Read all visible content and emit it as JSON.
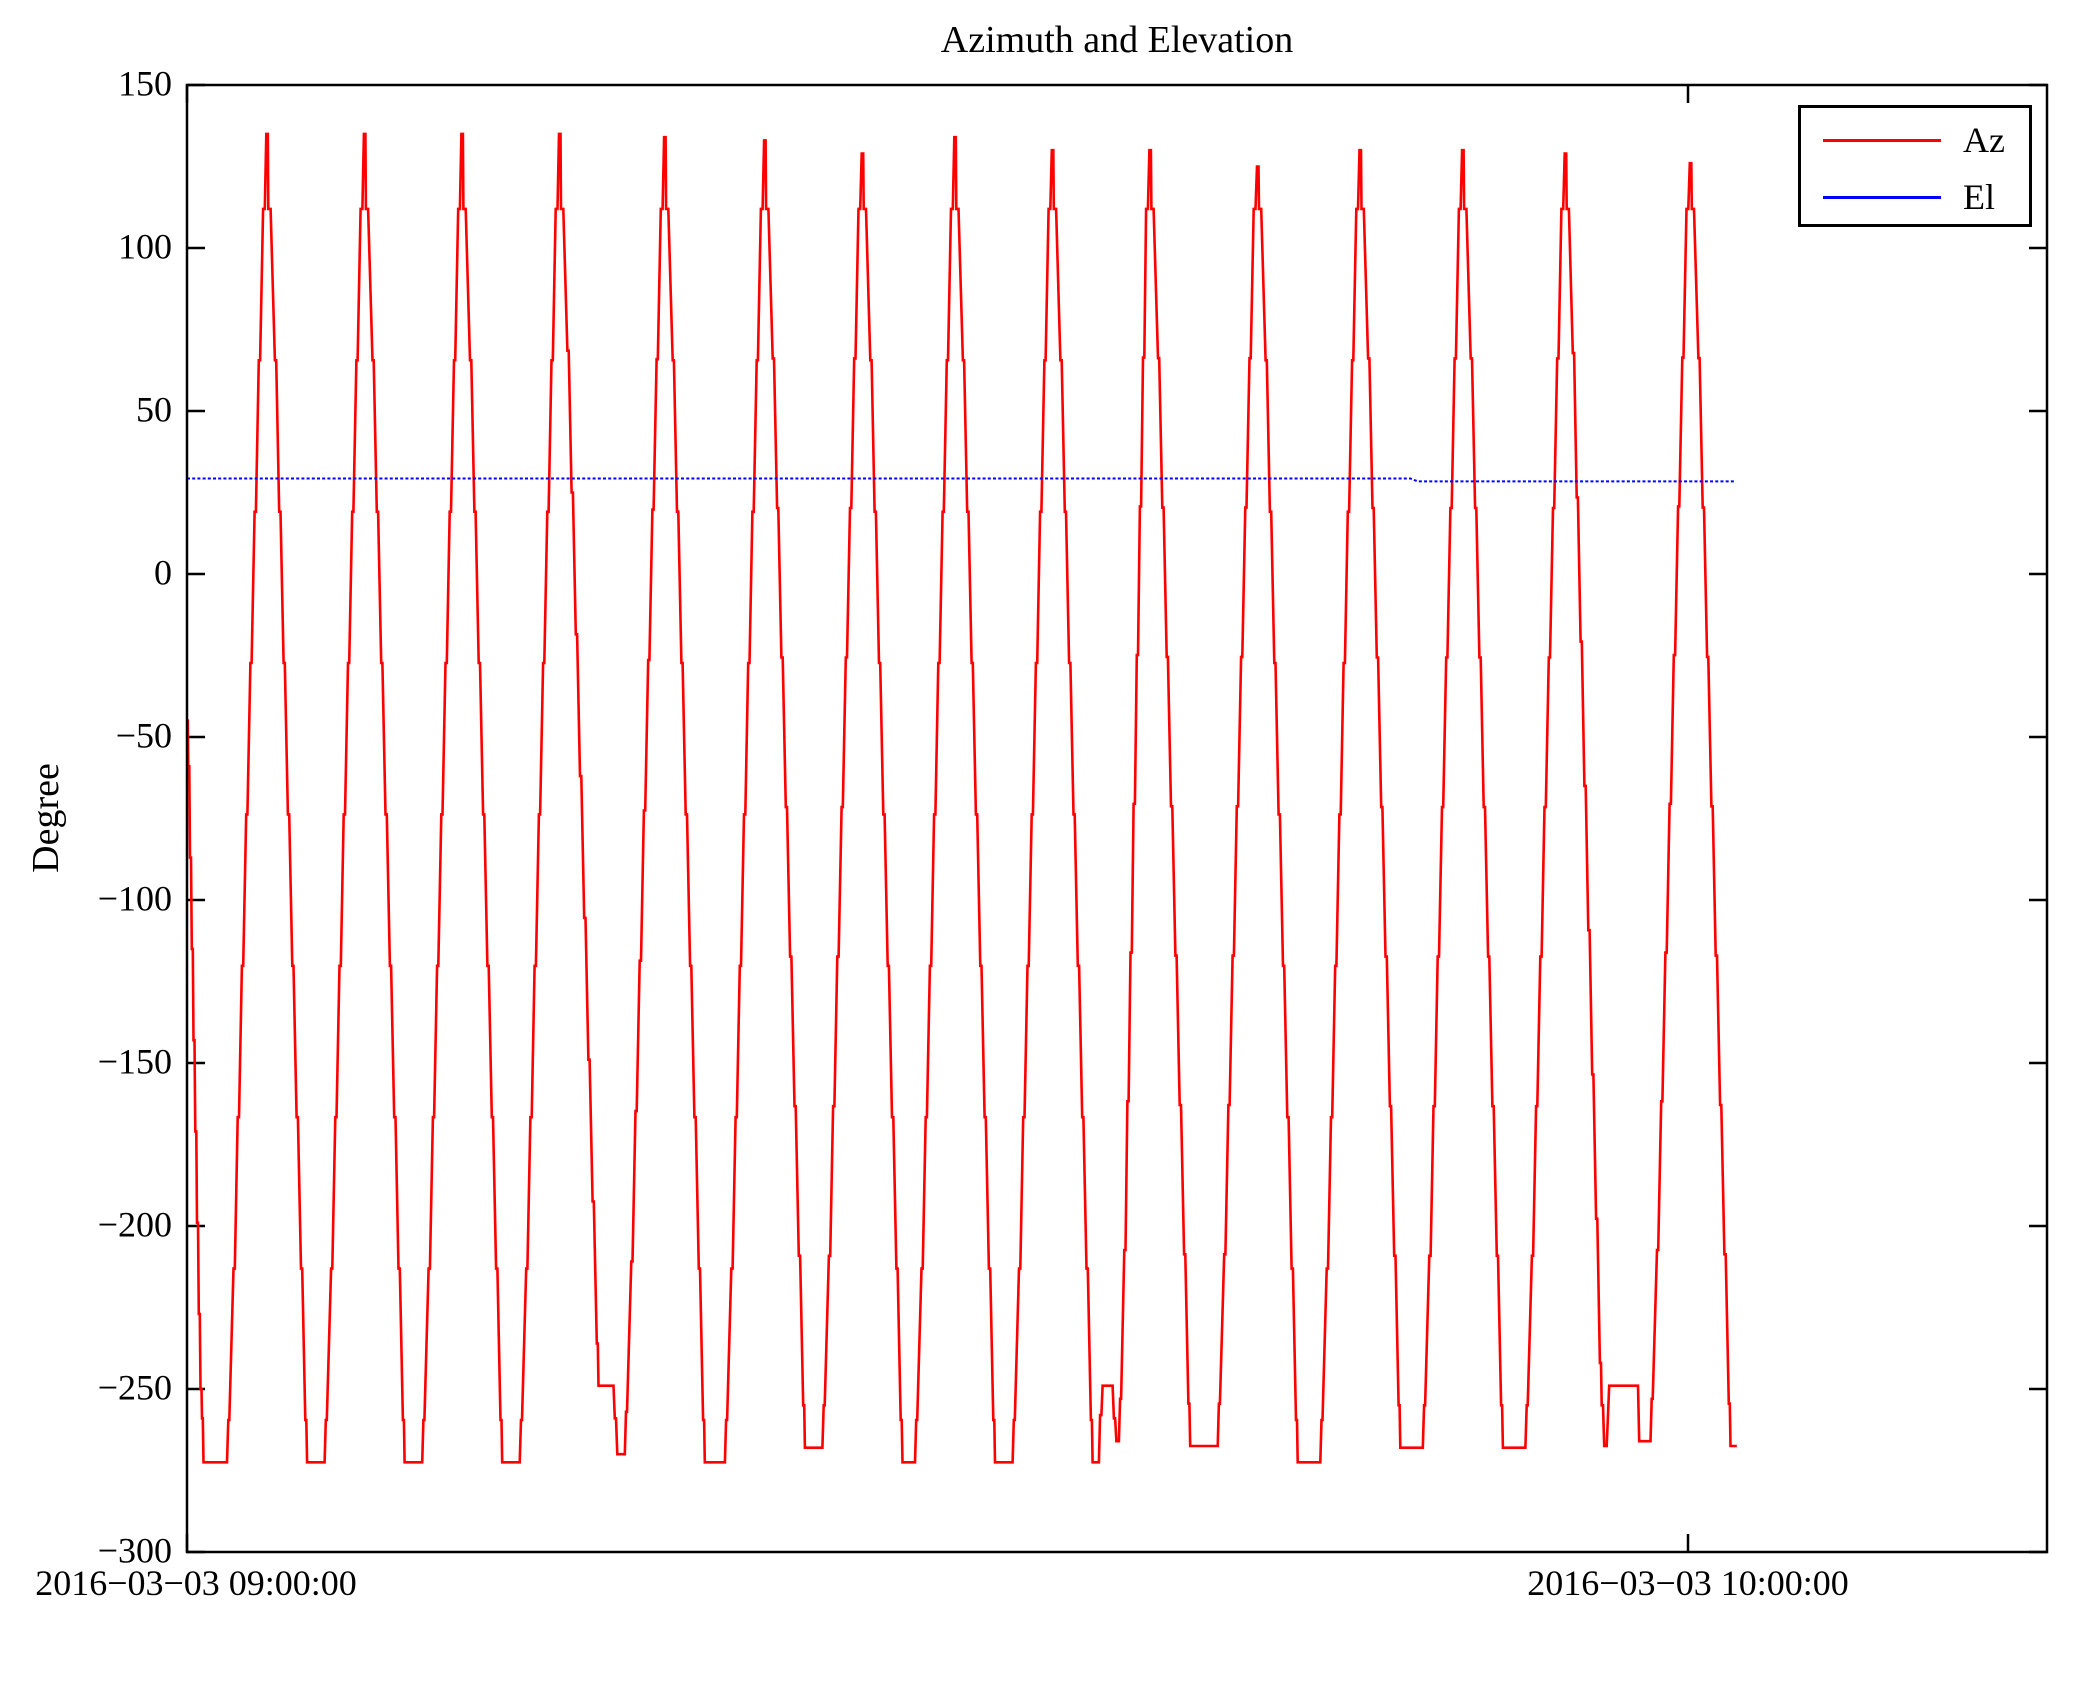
{
  "figure": {
    "background": "#ffffff"
  },
  "chart_data": {
    "type": "line",
    "title": "Azimuth and Elevation",
    "ylabel": "Degree",
    "grid": false,
    "ylim": [
      -300,
      150
    ],
    "yticks": [
      150,
      100,
      50,
      0,
      -50,
      -100,
      -150,
      -200,
      -250,
      -300
    ],
    "ytick_labels": [
      "150",
      "100",
      "50",
      "0",
      "−50",
      "−100",
      "−150",
      "−200",
      "−250",
      "−300"
    ],
    "xlim_minutes": [
      0,
      74.35
    ],
    "xticks": [
      {
        "t": 0,
        "label": "2016−03−03 09:00:00"
      },
      {
        "t": 60,
        "label": "2016−03−03 10:00:00"
      }
    ],
    "legend": {
      "position": "upper right",
      "entries": [
        {
          "label": "Az",
          "color": "#ff0000"
        },
        {
          "label": "El",
          "color": "#0000ff"
        }
      ]
    },
    "series": [
      {
        "name": "Az",
        "color": "#ff0000",
        "style": "solid",
        "description": "Azimuth sweeps repeatedly between about -273 and +135 degrees in stepped ramps, one cycle roughly every 4 minutes from 09:00 to 10:02",
        "initial_points": [
          [
            0,
            -45
          ],
          [
            0.03,
            -45
          ],
          [
            0.05,
            -59
          ],
          [
            0.09,
            -59
          ],
          [
            0.12,
            -87
          ],
          [
            0.16,
            -87
          ],
          [
            0.19,
            -115
          ],
          [
            0.23,
            -115
          ],
          [
            0.26,
            -143
          ],
          [
            0.3,
            -143
          ],
          [
            0.33,
            -171
          ],
          [
            0.37,
            -171
          ],
          [
            0.4,
            -199
          ],
          [
            0.44,
            -199
          ],
          [
            0.47,
            -227
          ],
          [
            0.51,
            -227
          ],
          [
            0.54,
            -250
          ],
          [
            0.58,
            -250
          ],
          [
            0.6,
            -259
          ],
          [
            0.63,
            -259
          ],
          [
            0.66,
            -272.5
          ]
        ],
        "cycles": [
          {
            "t": 3.2,
            "v": 135
          },
          {
            "t": 7.1,
            "v": 135
          },
          {
            "t": 11.0,
            "v": 135
          },
          {
            "t": 14.9,
            "v": 135
          },
          {
            "t": 19.1,
            "v": 134
          },
          {
            "t": 23.1,
            "v": 133
          },
          {
            "t": 27.0,
            "v": 129
          },
          {
            "t": 30.7,
            "v": 134
          },
          {
            "t": 34.6,
            "v": 130
          },
          {
            "t": 38.5,
            "v": 130
          },
          {
            "t": 42.8,
            "v": 125
          },
          {
            "t": 46.9,
            "v": 130
          },
          {
            "t": 51.0,
            "v": 130
          },
          {
            "t": 55.1,
            "v": 129
          },
          {
            "t": 60.1,
            "v": 126
          }
        ],
        "bottoms": [
          -272.5,
          -272.5,
          -272.5,
          {
            "shape": [
              [
                16.45,
                -249
              ],
              [
                17.05,
                -249
              ],
              [
                17.1,
                -259
              ],
              [
                17.15,
                -259
              ],
              [
                17.2,
                -270
              ],
              [
                17.35,
                -270
              ]
            ]
          },
          -272.5,
          -268,
          -272.5,
          -272.5,
          {
            "shape": [
              [
                36.2,
                -272.5
              ],
              [
                36.45,
                -272.5
              ],
              [
                36.5,
                -258
              ],
              [
                36.55,
                -258
              ],
              [
                36.6,
                -249
              ],
              [
                37.0,
                -249
              ],
              [
                37.05,
                -259
              ],
              [
                37.1,
                -259
              ],
              [
                37.15,
                -266
              ],
              [
                37.25,
                -266
              ]
            ]
          },
          -267.5,
          -272.5,
          -268,
          -268,
          {
            "shape": [
              [
                56.55,
                -255
              ],
              [
                56.6,
                -255
              ],
              [
                56.65,
                -267.5
              ],
              [
                56.75,
                -267.5
              ],
              [
                56.85,
                -249
              ],
              [
                58.0,
                -249
              ],
              [
                58.05,
                -266
              ],
              [
                58.3,
                -266
              ]
            ]
          },
          -267.5
        ],
        "edge": {
          "minutes": 1.6,
          "steps": 8,
          "jog_min": 0.05,
          "shoulder_v": 112,
          "prebottom_rise": 13,
          "peak_halfwidth_min": 0.03
        },
        "end_t": 61.95
      },
      {
        "name": "El",
        "color": "#0000ff",
        "style": "dotted",
        "description": "Elevation holds near 29 degrees, stepping down slightly to about 28.4 degrees at roughly 09:49",
        "points": [
          [
            0,
            29.3
          ],
          [
            48.9,
            29.3
          ],
          [
            49.2,
            28.4
          ],
          [
            61.9,
            28.4
          ]
        ]
      }
    ]
  }
}
